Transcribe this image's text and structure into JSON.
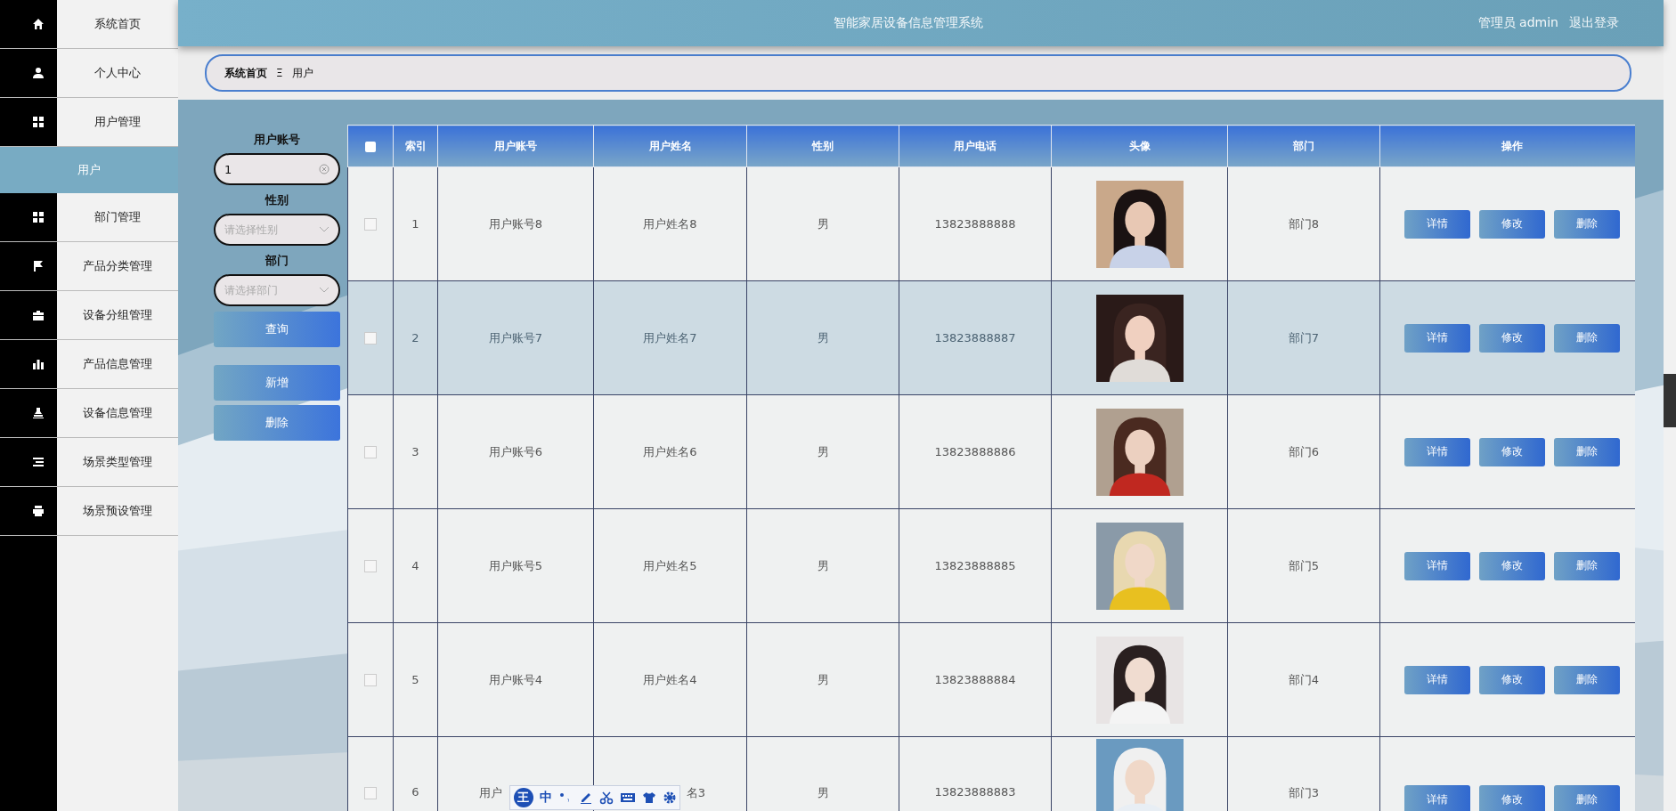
{
  "sidebar": {
    "items": [
      {
        "label": "系统首页",
        "selected": false
      },
      {
        "label": "个人中心",
        "selected": false
      },
      {
        "label": "用户管理",
        "selected": false,
        "expanded": true,
        "children": [
          {
            "label": "用户",
            "selected": true
          }
        ]
      },
      {
        "label": "部门管理",
        "selected": false
      },
      {
        "label": "产品分类管理",
        "selected": false
      },
      {
        "label": "设备分组管理",
        "selected": false
      },
      {
        "label": "产品信息管理",
        "selected": false
      },
      {
        "label": "设备信息管理",
        "selected": false
      },
      {
        "label": "场景类型管理",
        "selected": false
      },
      {
        "label": "场景预设管理",
        "selected": false
      }
    ]
  },
  "header": {
    "title": "智能家居设备信息管理系统",
    "user": "管理员 admin",
    "logout": "退出登录"
  },
  "breadcrumb": {
    "home": "系统首页",
    "separator": "Ξ",
    "current": "用户"
  },
  "filters": {
    "account_label": "用户账号",
    "account_value": "1",
    "gender_label": "性别",
    "gender_placeholder": "请选择性别",
    "dept_label": "部门",
    "dept_placeholder": "请选择部门",
    "buttons": [
      "查询",
      "新增",
      "删除"
    ]
  },
  "table": {
    "all_checked": false,
    "columns": [
      "索引",
      "用户账号",
      "用户姓名",
      "性别",
      "用户电话",
      "头像",
      "部门",
      "操作"
    ],
    "rows": [
      {
        "checked": false,
        "hovered": false,
        "index": "1",
        "account": "用户账号8",
        "name": "用户姓名8",
        "gender": "男",
        "phone": "13823888888",
        "dept": "部门8",
        "actions": [
          "详情",
          "修改",
          "删除"
        ]
      },
      {
        "checked": false,
        "hovered": true,
        "index": "2",
        "account": "用户账号7",
        "name": "用户姓名7",
        "gender": "男",
        "phone": "13823888887",
        "dept": "部门7",
        "actions": [
          "详情",
          "修改",
          "删除"
        ]
      },
      {
        "checked": false,
        "hovered": false,
        "index": "3",
        "account": "用户账号6",
        "name": "用户姓名6",
        "gender": "男",
        "phone": "13823888886",
        "dept": "部门6",
        "actions": [
          "详情",
          "修改",
          "删除"
        ]
      },
      {
        "checked": false,
        "hovered": false,
        "index": "4",
        "account": "用户账号5",
        "name": "用户姓名5",
        "gender": "男",
        "phone": "13823888885",
        "dept": "部门5",
        "actions": [
          "详情",
          "修改",
          "删除"
        ]
      },
      {
        "checked": false,
        "hovered": false,
        "index": "5",
        "account": "用户账号4",
        "name": "用户姓名4",
        "gender": "男",
        "phone": "13823888884",
        "dept": "部门4",
        "actions": [
          "详情",
          "修改",
          "删除"
        ]
      },
      {
        "checked": false,
        "hovered": false,
        "index": "6",
        "account": "用户",
        "name": "名3",
        "gender": "男",
        "phone": "13823888883",
        "dept": "部门3",
        "actions": [
          "详情",
          "修改",
          "删除"
        ]
      }
    ]
  },
  "ime_toolbar": {
    "logo": "王",
    "mode": "中"
  }
}
